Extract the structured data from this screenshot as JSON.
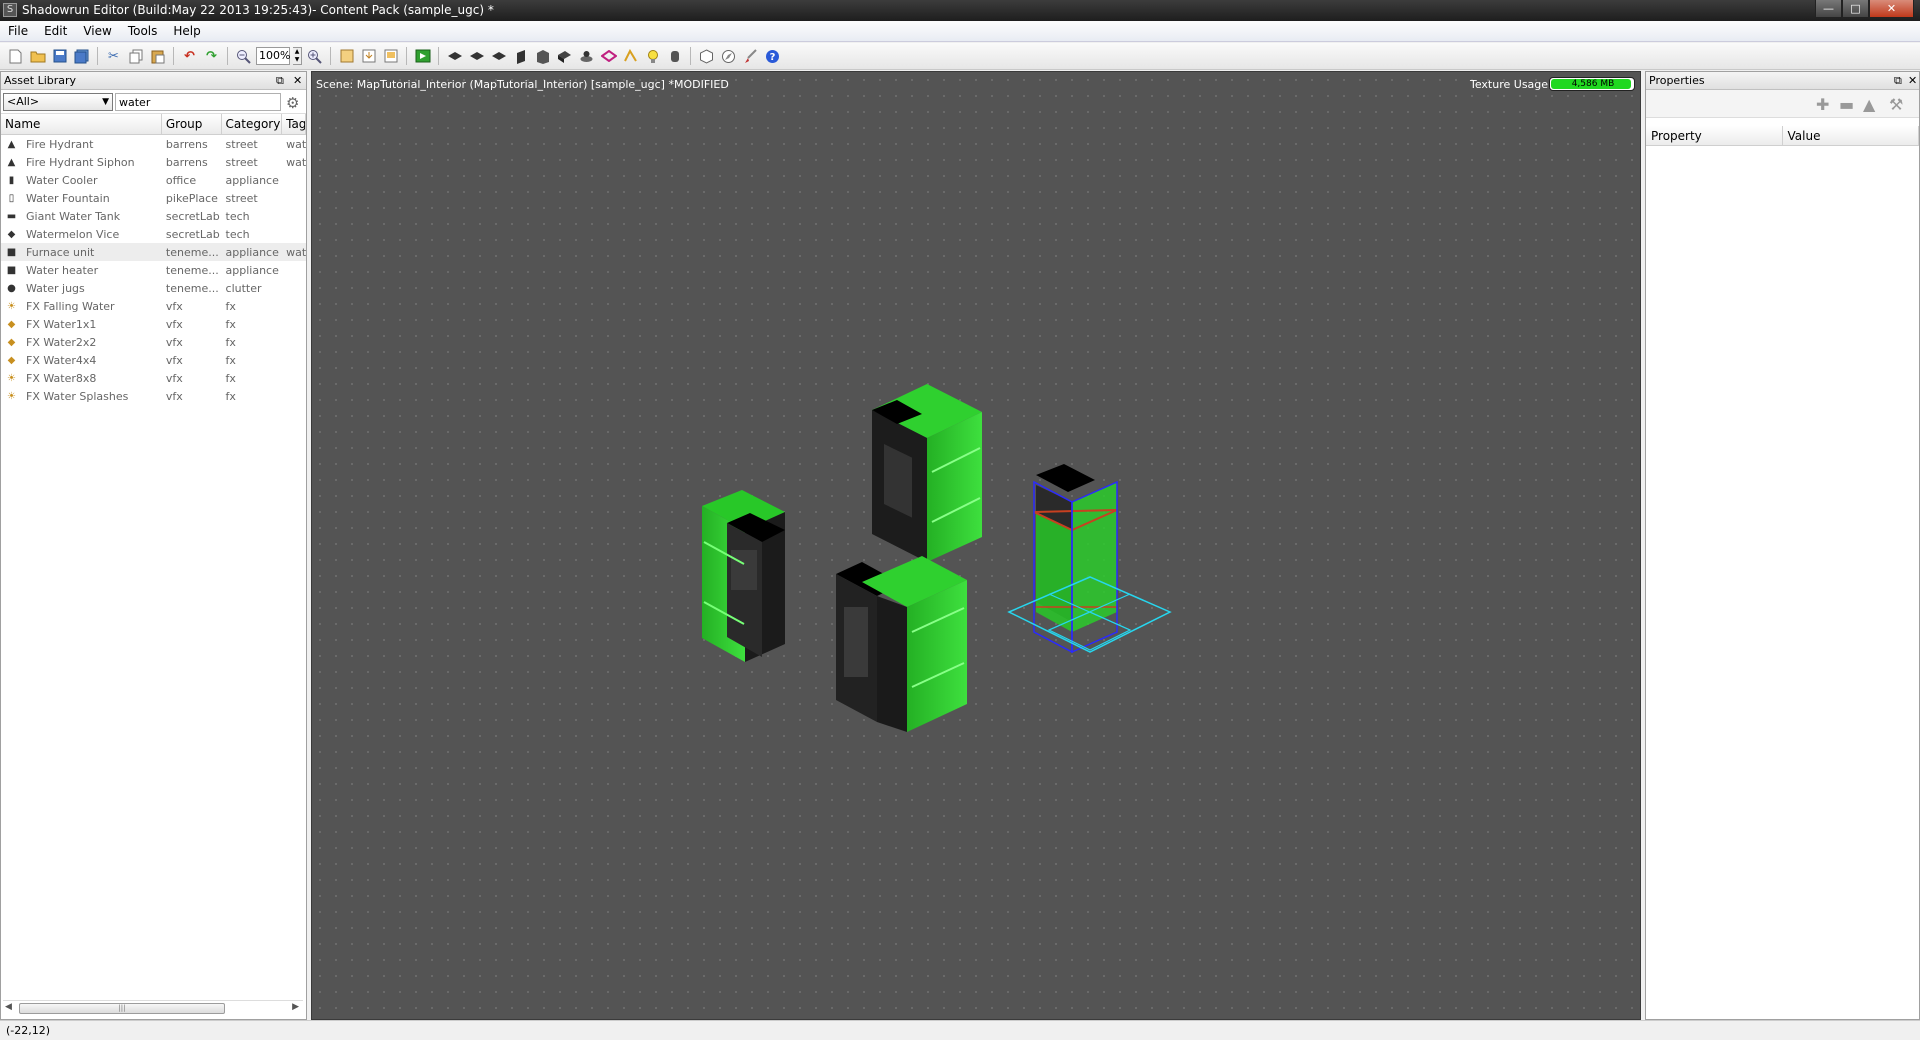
{
  "window": {
    "title": "Shadowrun Editor (Build:May 22 2013 19:25:43)- Content Pack (sample_ugc) *",
    "controls": [
      "minimize",
      "maximize",
      "close"
    ]
  },
  "menu": [
    "File",
    "Edit",
    "View",
    "Tools",
    "Help"
  ],
  "toolbar": {
    "zoom": "100%"
  },
  "asset_library": {
    "title": "Asset Library",
    "filter_select": "<All>",
    "search_value": "water",
    "columns": [
      "Name",
      "Group",
      "Category",
      "Tags"
    ],
    "rows": [
      {
        "name": "Fire Hydrant",
        "group": "barrens",
        "category": "street",
        "tags": "water",
        "icon": "hydrant-icon"
      },
      {
        "name": "Fire Hydrant Siphon",
        "group": "barrens",
        "category": "street",
        "tags": "water",
        "icon": "hydrant-icon"
      },
      {
        "name": "Water Cooler",
        "group": "office",
        "category": "appliance",
        "tags": "",
        "icon": "cooler-icon"
      },
      {
        "name": "Water Fountain",
        "group": "pikePlace",
        "category": "street",
        "tags": "",
        "icon": "fountain-icon"
      },
      {
        "name": "Giant Water Tank",
        "group": "secretLab",
        "category": "tech",
        "tags": "",
        "icon": "tank-icon"
      },
      {
        "name": "Watermelon Vice",
        "group": "secretLab",
        "category": "tech",
        "tags": "",
        "icon": "vice-icon"
      },
      {
        "name": "Furnace unit",
        "group": "teneme...",
        "category": "appliance",
        "tags": "water",
        "icon": "furnace-icon"
      },
      {
        "name": "Water heater",
        "group": "teneme...",
        "category": "appliance",
        "tags": "",
        "icon": "heater-icon"
      },
      {
        "name": "Water jugs",
        "group": "teneme...",
        "category": "clutter",
        "tags": "",
        "icon": "jugs-icon"
      },
      {
        "name": "FX Falling Water",
        "group": "vfx",
        "category": "fx",
        "tags": "",
        "icon": "fx-icon"
      },
      {
        "name": "FX Water1x1",
        "group": "vfx",
        "category": "fx",
        "tags": "",
        "icon": "fx-plane-icon"
      },
      {
        "name": "FX Water2x2",
        "group": "vfx",
        "category": "fx",
        "tags": "",
        "icon": "fx-plane-icon"
      },
      {
        "name": "FX Water4x4",
        "group": "vfx",
        "category": "fx",
        "tags": "",
        "icon": "fx-plane-icon"
      },
      {
        "name": "FX Water8x8",
        "group": "vfx",
        "category": "fx",
        "tags": "",
        "icon": "fx-icon"
      },
      {
        "name": "FX Water Splashes",
        "group": "vfx",
        "category": "fx",
        "tags": "",
        "icon": "fx-icon"
      }
    ]
  },
  "scene": {
    "label": "Scene: MapTutorial_Interior (MapTutorial_Interior) [sample_ugc] *MODIFIED",
    "texture_label": "Texture Usage:",
    "texture_value": "4,586 MB",
    "texture_fraction": 0.98,
    "colors": {
      "background": "#545454",
      "object_green": "#2fd02f",
      "selection": "#27d6ee"
    }
  },
  "properties": {
    "title": "Properties",
    "columns": [
      "Property",
      "Value"
    ]
  },
  "status": {
    "coords": "(-22,12)"
  }
}
